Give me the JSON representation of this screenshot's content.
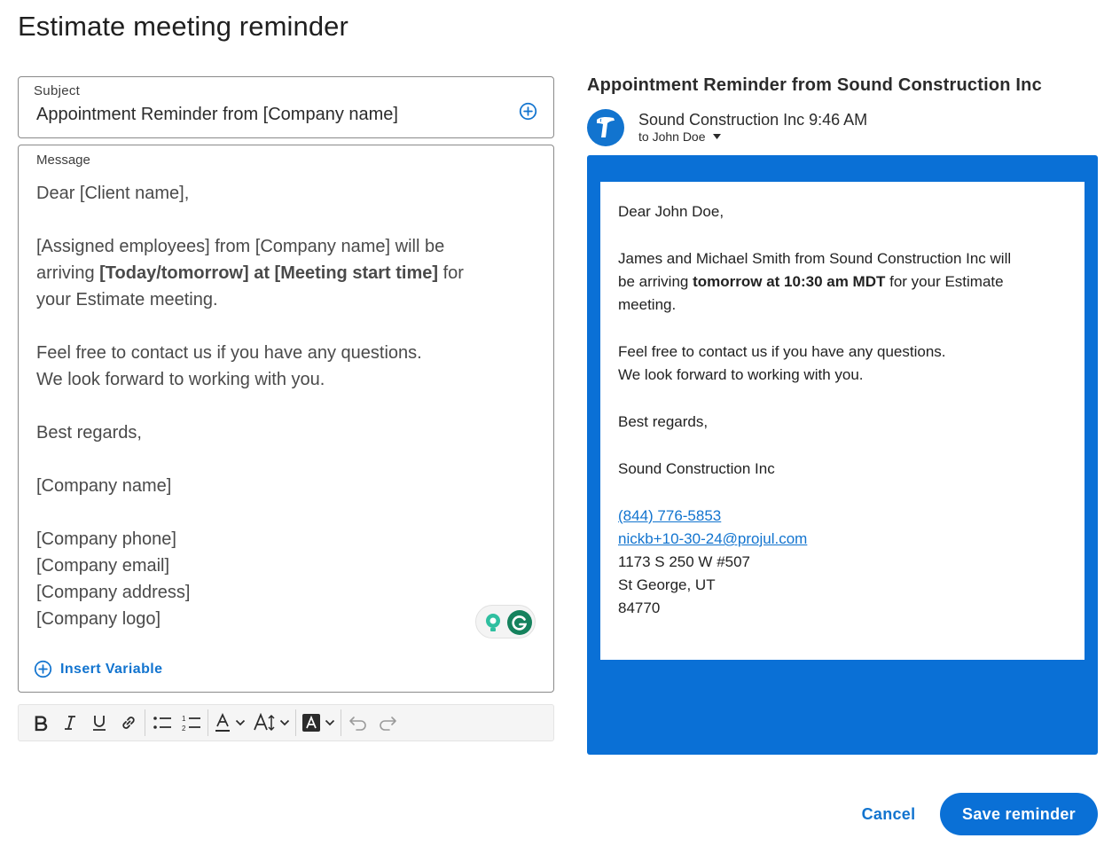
{
  "page": {
    "title": "Estimate meeting reminder"
  },
  "subject": {
    "label": "Subject",
    "value": "Appointment Reminder from [Company name]",
    "add_icon": "plus-circle-icon"
  },
  "message": {
    "label": "Message",
    "lines": [
      "Dear [Client name],",
      "",
      "[Assigned employees] from [Company name] will be",
      {
        "prefix": "arriving ",
        "bold": "[Today/tomorrow] at [Meeting start time]",
        "suffix": " for"
      },
      "your Estimate meeting.",
      "",
      "Feel free to contact us if you have any questions.",
      "We look forward to working with you.",
      "",
      "Best regards,",
      "",
      "[Company name]",
      "",
      "[Company phone]",
      "[Company email]",
      "[Company address]",
      "[Company logo]"
    ],
    "insert_variable_label": "Insert Variable"
  },
  "toolbar": {
    "buttons": [
      "bold-icon",
      "italic-icon",
      "underline-icon",
      "link-icon",
      "bulleted-list-icon",
      "numbered-list-icon",
      "text-color-icon",
      "font-size-icon",
      "highlight-color-icon",
      "undo-icon",
      "redo-icon"
    ]
  },
  "preview": {
    "title": "Appointment Reminder from Sound Construction Inc",
    "sender": "Sound Construction Inc 9:46 AM",
    "recipient": "to John Doe",
    "greeting": "Dear John Doe,",
    "arrival_line1": "James and Michael Smith from Sound Construction Inc will",
    "arrival_prefix": "be arriving ",
    "arrival_bold": "tomorrow at 10:30 am MDT",
    "arrival_suffix": " for your Estimate",
    "arrival_line3": "meeting.",
    "contact_line1": "Feel free to contact us if you have any questions.",
    "contact_line2": "We look forward to working with you.",
    "regards": "Best regards,",
    "company": "Sound Construction Inc",
    "phone": "(844) 776-5853",
    "email": "nickb+10-30-24@projul.com",
    "address_line1": "1173 S 250 W #507",
    "address_line2": "St George, UT",
    "zip": "84770",
    "frame_color": "#0A70D6",
    "link_color": "#1274CF"
  },
  "footer": {
    "cancel_label": "Cancel",
    "save_label": "Save reminder"
  }
}
